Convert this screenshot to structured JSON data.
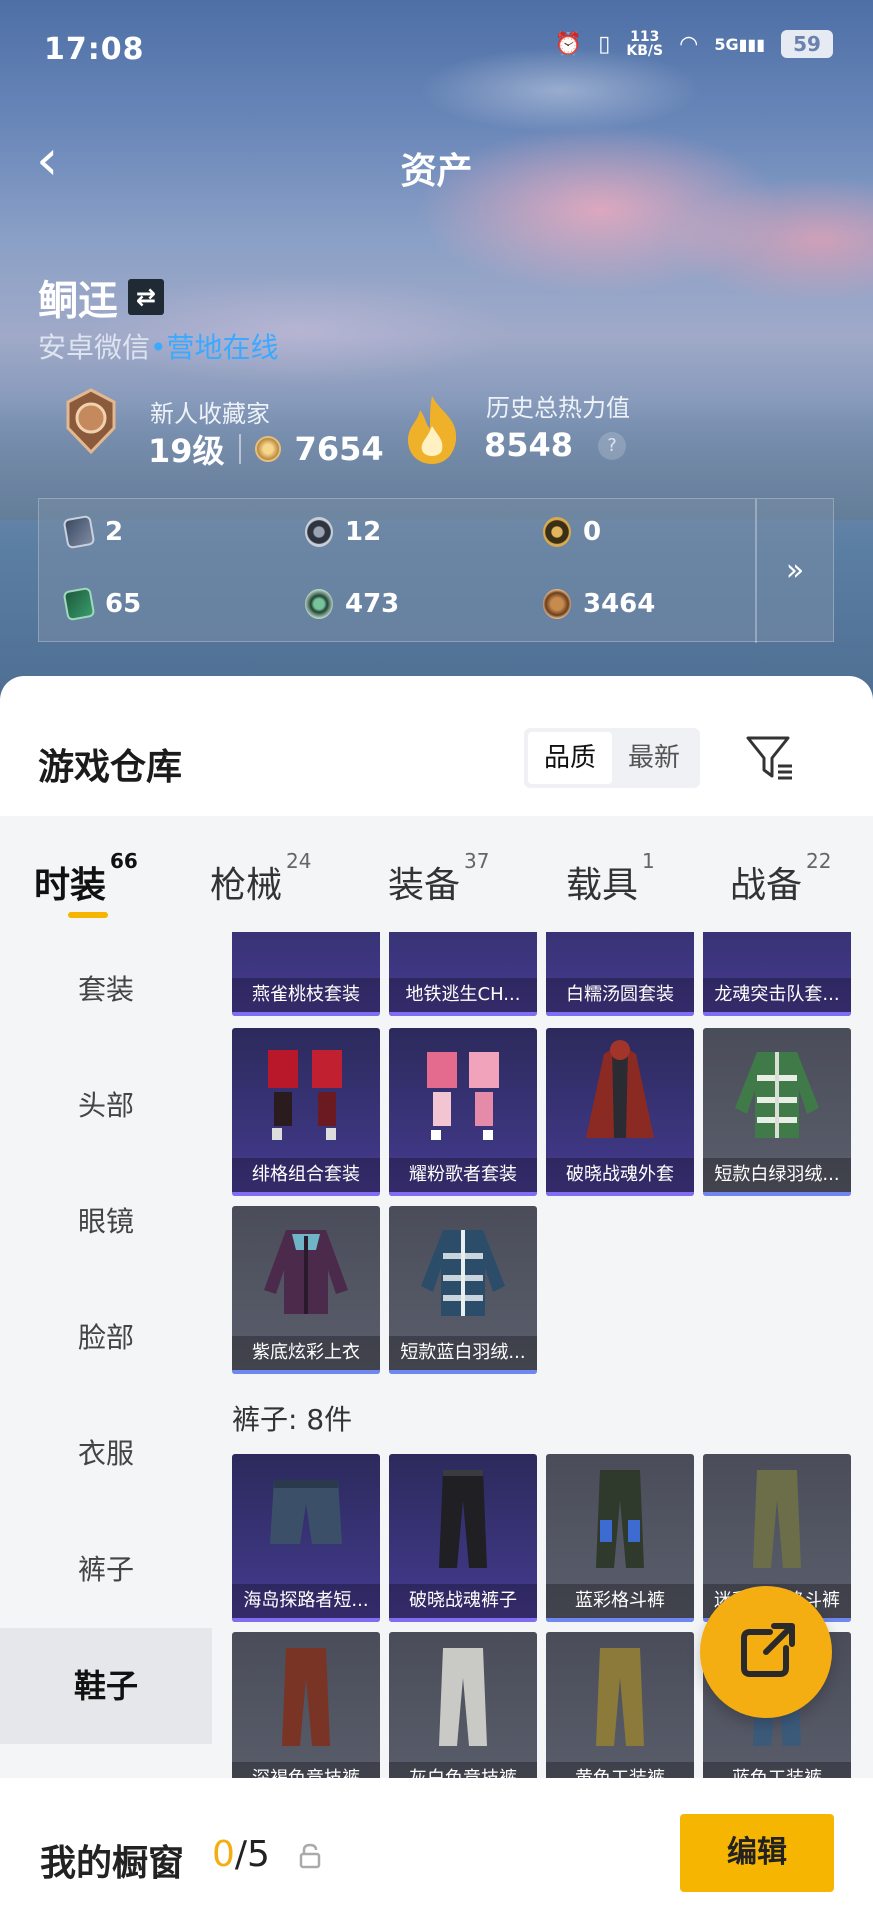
{
  "status_bar": {
    "time": "17:08",
    "net_speed": "113",
    "net_unit": "KB/S",
    "signal": "5G",
    "battery": "59"
  },
  "header": {
    "title": "资产"
  },
  "user": {
    "name": "鲖迋",
    "platform": "安卓微信",
    "status": "营地在线"
  },
  "stats": {
    "collector_title": "新人收藏家",
    "level": "19级",
    "points": "7654",
    "heat_label": "历史总热力值",
    "heat_value": "8548",
    "help": "?"
  },
  "assets": [
    {
      "icon": "card-icon",
      "value": "2"
    },
    {
      "icon": "silver-coin-icon",
      "value": "12"
    },
    {
      "icon": "gold-coin-icon",
      "value": "0"
    },
    {
      "icon": "green-card-icon",
      "value": "65"
    },
    {
      "icon": "green-coin-icon",
      "value": "473"
    },
    {
      "icon": "bronze-coin-icon",
      "value": "3464"
    }
  ],
  "assets_more": "»",
  "warehouse": {
    "title": "游戏仓库",
    "sort_options": [
      "品质",
      "最新"
    ],
    "sort_selected": "品质"
  },
  "tabs": [
    {
      "label": "时装",
      "count": "66"
    },
    {
      "label": "枪械",
      "count": "24"
    },
    {
      "label": "装备",
      "count": "37"
    },
    {
      "label": "载具",
      "count": "1"
    },
    {
      "label": "战备",
      "count": "22"
    }
  ],
  "sidebar": [
    "套装",
    "头部",
    "眼镜",
    "脸部",
    "衣服",
    "裤子",
    "鞋子"
  ],
  "sidebar_selected": "鞋子",
  "grid_top_row": [
    "燕雀桃枝套装",
    "地铁逃生CH...",
    "白糯汤圆套装",
    "龙魂突击队套..."
  ],
  "grid_row2": [
    "绯格组合套装",
    "耀粉歌者套装",
    "破晓战魂外套",
    "短款白绿羽绒..."
  ],
  "grid_row3": [
    "紫底炫彩上衣",
    "短款蓝白羽绒..."
  ],
  "pants_section": "裤子: 8件",
  "pants_row1": [
    "海岛探路者短...",
    "破晓战魂裤子",
    "蓝彩格斗裤",
    "迷彩工装格斗裤"
  ],
  "pants_row2": [
    "深褐色竞技裤",
    "灰白色竞技裤",
    "黄色工装裤",
    "蓝色工装裤"
  ],
  "bottom": {
    "label": "我的橱窗",
    "current": "0",
    "total": "/5",
    "edit": "编辑"
  },
  "colors": {
    "accent": "#f5b500",
    "online": "#3ba9ff",
    "tile_purple": "#3d3680",
    "tile_grey": "#4a4d59"
  }
}
